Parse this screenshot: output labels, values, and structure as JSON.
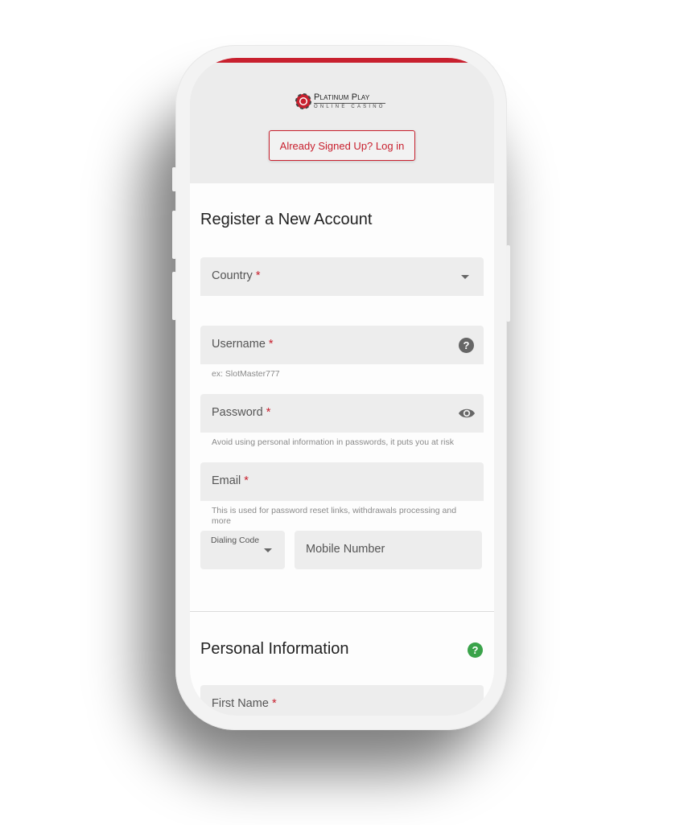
{
  "brand": {
    "name": "Platinum Play",
    "tagline": "ONLINE CASINO",
    "accent_color": "#c8202e"
  },
  "header": {
    "login_button": "Already Signed Up? Log in"
  },
  "register": {
    "title": "Register a New Account",
    "fields": {
      "country": {
        "label": "Country",
        "required": "*"
      },
      "username": {
        "label": "Username",
        "required": "*",
        "helper": "ex: SlotMaster777"
      },
      "password": {
        "label": "Password",
        "required": "*",
        "helper": "Avoid using personal information in passwords, it puts you at risk"
      },
      "email": {
        "label": "Email",
        "required": "*",
        "helper": "This is used for password reset links, withdrawals processing and more"
      },
      "dialing_code": {
        "label": "Dialing Code"
      },
      "mobile": {
        "label": "Mobile Number"
      }
    }
  },
  "personal": {
    "title": "Personal Information",
    "help_color": "#3aa34a",
    "fields": {
      "first_name": {
        "label": "First Name",
        "required": "*"
      }
    }
  }
}
